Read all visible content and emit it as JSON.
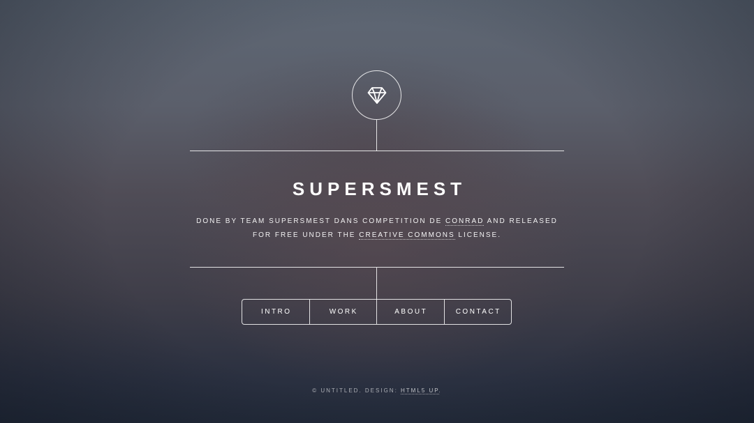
{
  "header": {
    "logo_icon": "diamond-icon",
    "title": "SUPERSMEST",
    "tagline": {
      "part1": "Done by team supersmest dans competition de ",
      "link1": "Conrad",
      "part2": " and released for free under the ",
      "link2": "Creative Commons",
      "part3": " license."
    }
  },
  "nav": {
    "items": [
      {
        "label": "INTRO"
      },
      {
        "label": "WORK"
      },
      {
        "label": "ABOUT"
      },
      {
        "label": "CONTACT"
      }
    ]
  },
  "footer": {
    "copyright": "© UNTITLED. DESIGN: ",
    "design_link": "HTML5 UP",
    "end": "."
  },
  "colors": {
    "text": "#ffffff",
    "background_top": "#5e6774",
    "background_bottom": "#222a39"
  }
}
